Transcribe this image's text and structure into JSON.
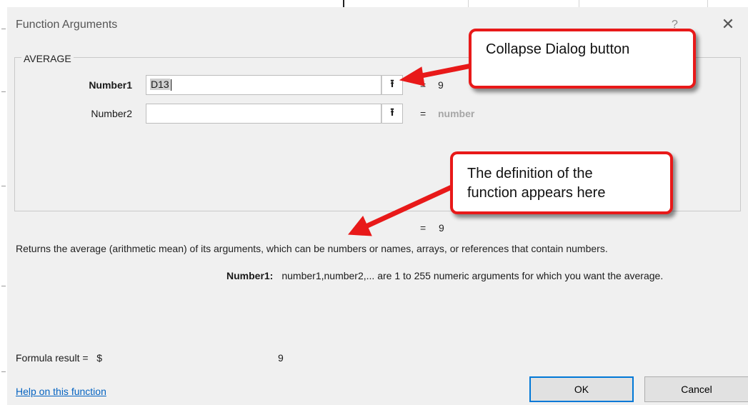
{
  "dialog": {
    "title": "Function Arguments",
    "help_glyph": "?",
    "close_glyph": "✕"
  },
  "function": {
    "name": "AVERAGE",
    "args": [
      {
        "label": "Number1",
        "value": "D13",
        "result": "9",
        "bold": true
      },
      {
        "label": "Number2",
        "value": "",
        "result": "number",
        "bold": false
      }
    ],
    "overall_result": "9",
    "description": "Returns the average (arithmetic mean) of its arguments, which can be numbers or names, arrays, or references that contain numbers.",
    "arg_help_name": "Number1:",
    "arg_help_text": "number1,number2,... are 1 to 255 numeric arguments for which you want the average."
  },
  "formula_result": {
    "label": "Formula result =",
    "currency": "$",
    "value": "9"
  },
  "footer": {
    "help_link": "Help on this function",
    "ok_label": "OK",
    "cancel_label": "Cancel"
  },
  "equals_sign": "=",
  "collapse_glyph": "⭱",
  "callouts": {
    "collapse": "Collapse Dialog button",
    "definition_line1": "The definition of the",
    "definition_line2": "function appears here"
  },
  "colors": {
    "callout_border": "#e81919",
    "link": "#0563c1",
    "ok_focus": "#0078d7"
  }
}
